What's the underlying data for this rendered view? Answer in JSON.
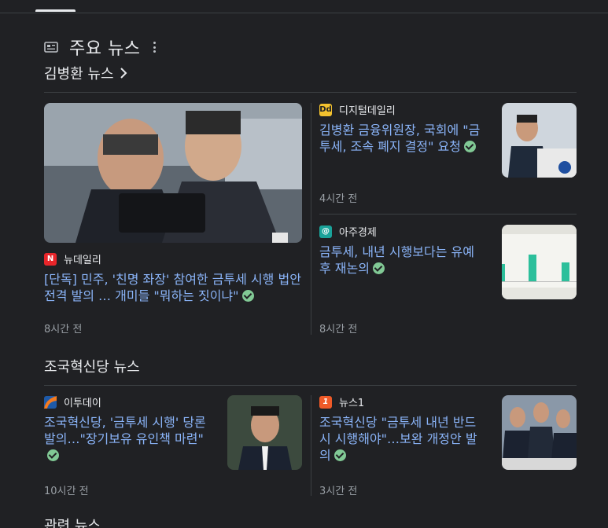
{
  "section": {
    "title": "주요 뉴스",
    "icon": "newspaper-icon",
    "menu_icon": "more-vert-icon"
  },
  "topics": [
    {
      "title": "김병환 뉴스",
      "link": true,
      "articles": [
        {
          "source": "뉴데일리",
          "logo_text": "N",
          "logo_color": "#e8252a",
          "headline": "[단독] 민주, '친명 좌장' 참여한 금투세 시행 법안 전격 발의 … 개미들 \"뭐하는 짓이냐\"",
          "time": "8시간 전",
          "verified": true
        },
        {
          "source": "디지털데일리",
          "logo_text": "Dd",
          "logo_color": "#f2c12e",
          "headline": "김병환 금융위원장, 국회에 \"금투세, 조속 폐지 결정\" 요청",
          "time": "4시간 전",
          "verified": true
        },
        {
          "source": "아주경제",
          "logo_text": "@",
          "logo_color": "#1aa39a",
          "headline": "금투세, 내년 시행보다는 유예 후 재논의",
          "time": "8시간 전",
          "verified": true
        }
      ]
    },
    {
      "title": "조국혁신당 뉴스",
      "link": false,
      "articles": [
        {
          "source": "이투데이",
          "logo_text": "",
          "logo_color": "#1e5aa8",
          "headline": "조국혁신당, '금투세 시행' 당론발의…\"장기보유 유인책 마련\"",
          "time": "10시간 전",
          "verified": true
        },
        {
          "source": "뉴스1",
          "logo_text": "1",
          "logo_color": "#ef5a28",
          "headline": "조국혁신당 \"금투세 내년 반드시 시행해야\"…보완 개정안 발의",
          "time": "3시간 전",
          "verified": true
        }
      ]
    }
  ],
  "next_section": {
    "title": "관련 뉴스"
  }
}
